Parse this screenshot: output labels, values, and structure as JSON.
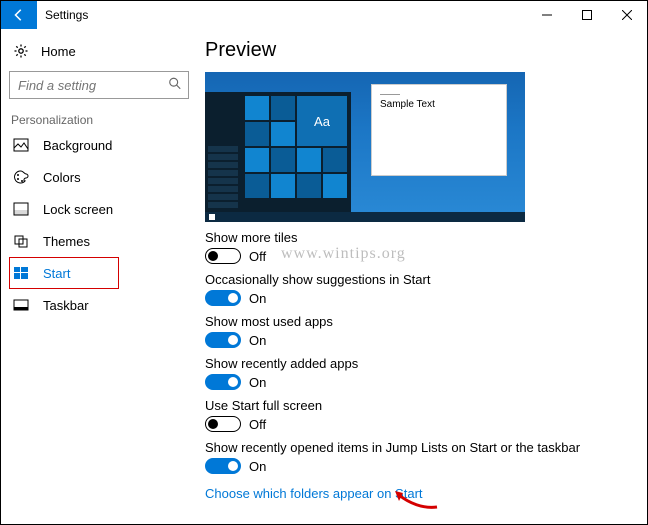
{
  "window": {
    "title": "Settings"
  },
  "sidebar": {
    "home_label": "Home",
    "search_placeholder": "Find a setting",
    "group_label": "Personalization",
    "items": [
      {
        "label": "Background"
      },
      {
        "label": "Colors"
      },
      {
        "label": "Lock screen"
      },
      {
        "label": "Themes"
      },
      {
        "label": "Start"
      },
      {
        "label": "Taskbar"
      }
    ]
  },
  "main": {
    "heading": "Preview",
    "preview": {
      "tile_text": "Aa",
      "window_sample_text": "Sample Text"
    },
    "settings": [
      {
        "label": "Show more tiles",
        "state": "Off",
        "on": false
      },
      {
        "label": "Occasionally show suggestions in Start",
        "state": "On",
        "on": true
      },
      {
        "label": "Show most used apps",
        "state": "On",
        "on": true
      },
      {
        "label": "Show recently added apps",
        "state": "On",
        "on": true
      },
      {
        "label": "Use Start full screen",
        "state": "Off",
        "on": false
      },
      {
        "label": "Show recently opened items in Jump Lists on Start or the taskbar",
        "state": "On",
        "on": true
      }
    ],
    "link_label": "Choose which folders appear on Start"
  },
  "watermark": "www.wintips.org"
}
